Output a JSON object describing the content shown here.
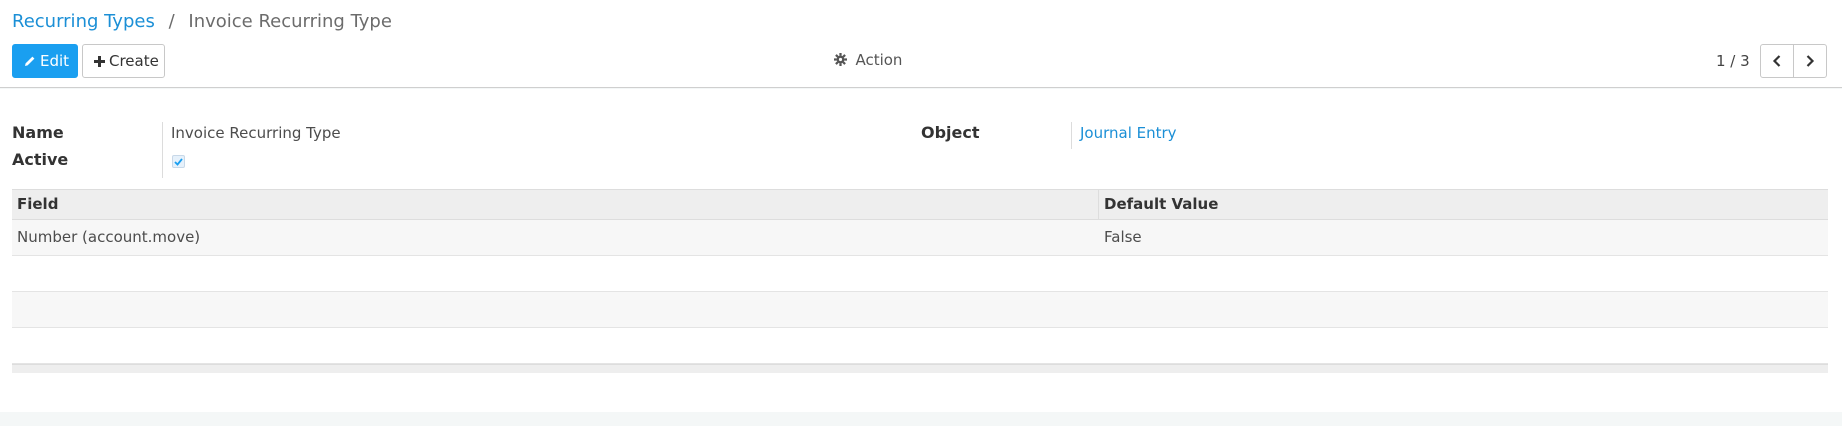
{
  "breadcrumb": {
    "parent": "Recurring Types",
    "separator": "/",
    "current": "Invoice Recurring Type"
  },
  "toolbar": {
    "edit_label": "Edit",
    "create_label": "Create",
    "action_label": "Action"
  },
  "pager": {
    "value": "1 / 3"
  },
  "form": {
    "name_label": "Name",
    "name_value": "Invoice Recurring Type",
    "active_label": "Active",
    "active_checked": true,
    "object_label": "Object",
    "object_value": "Journal Entry"
  },
  "table": {
    "columns": [
      "Field",
      "Default Value"
    ],
    "rows": [
      {
        "field": "Number (account.move)",
        "default_value": "False"
      }
    ]
  },
  "icons": {
    "edit": "pencil-icon",
    "create": "plus-icon",
    "action": "gear-icon",
    "prev": "chevron-left-icon",
    "next": "chevron-right-icon"
  },
  "colors": {
    "accent": "#1a9ff0",
    "link": "#1b8fd6",
    "background": "#f4f7f7"
  }
}
